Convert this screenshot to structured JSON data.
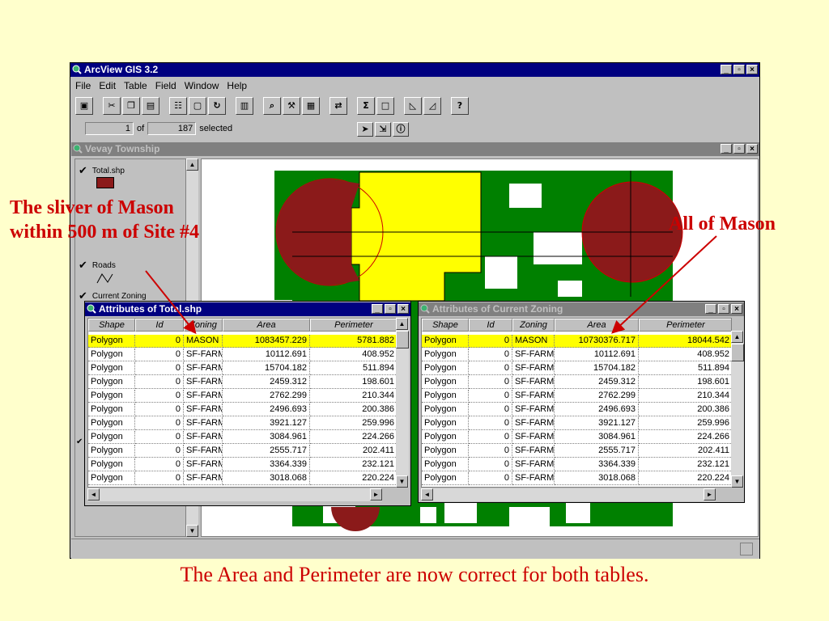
{
  "app": {
    "title": "ArcView GIS 3.2"
  },
  "menu": [
    "File",
    "Edit",
    "Table",
    "Field",
    "Window",
    "Help"
  ],
  "status": {
    "selected_count": "1",
    "of_label": "of",
    "total_count": "187",
    "selected_label": "selected"
  },
  "view": {
    "title": "Vevay Township",
    "toc_items": [
      {
        "label": "Total.shp",
        "checked": true
      },
      {
        "label": "Roads",
        "checked": true
      },
      {
        "label": "Current Zoning",
        "checked": true
      }
    ]
  },
  "tables": {
    "left": {
      "title": "Attributes of Total.shp",
      "columns": [
        "Shape",
        "Id",
        "Zoning",
        "Area",
        "Perimeter"
      ],
      "rows": [
        [
          "Polygon",
          "0",
          "MASON",
          "1083457.229",
          "5781.882"
        ],
        [
          "Polygon",
          "0",
          "SF-FARM",
          "10112.691",
          "408.952"
        ],
        [
          "Polygon",
          "0",
          "SF-FARM",
          "15704.182",
          "511.894"
        ],
        [
          "Polygon",
          "0",
          "SF-FARM",
          "2459.312",
          "198.601"
        ],
        [
          "Polygon",
          "0",
          "SF-FARM",
          "2762.299",
          "210.344"
        ],
        [
          "Polygon",
          "0",
          "SF-FARM",
          "2496.693",
          "200.386"
        ],
        [
          "Polygon",
          "0",
          "SF-FARM",
          "3921.127",
          "259.996"
        ],
        [
          "Polygon",
          "0",
          "SF-FARM",
          "3084.961",
          "224.266"
        ],
        [
          "Polygon",
          "0",
          "SF-FARM",
          "2555.717",
          "202.411"
        ],
        [
          "Polygon",
          "0",
          "SF-FARM",
          "3364.339",
          "232.121"
        ],
        [
          "Polygon",
          "0",
          "SF-FARM",
          "3018.068",
          "220.224"
        ]
      ]
    },
    "right": {
      "title": "Attributes of Current Zoning",
      "columns": [
        "Shape",
        "Id",
        "Zoning",
        "Area",
        "Perimeter"
      ],
      "rows": [
        [
          "Polygon",
          "0",
          "MASON",
          "10730376.717",
          "18044.542"
        ],
        [
          "Polygon",
          "0",
          "SF-FARM",
          "10112.691",
          "408.952"
        ],
        [
          "Polygon",
          "0",
          "SF-FARM",
          "15704.182",
          "511.894"
        ],
        [
          "Polygon",
          "0",
          "SF-FARM",
          "2459.312",
          "198.601"
        ],
        [
          "Polygon",
          "0",
          "SF-FARM",
          "2762.299",
          "210.344"
        ],
        [
          "Polygon",
          "0",
          "SF-FARM",
          "2496.693",
          "200.386"
        ],
        [
          "Polygon",
          "0",
          "SF-FARM",
          "3921.127",
          "259.996"
        ],
        [
          "Polygon",
          "0",
          "SF-FARM",
          "3084.961",
          "224.266"
        ],
        [
          "Polygon",
          "0",
          "SF-FARM",
          "2555.717",
          "202.411"
        ],
        [
          "Polygon",
          "0",
          "SF-FARM",
          "3364.339",
          "232.121"
        ],
        [
          "Polygon",
          "0",
          "SF-FARM",
          "3018.068",
          "220.224"
        ]
      ]
    }
  },
  "annotations": {
    "left_line1": "The sliver of Mason",
    "left_line2": "within 500 m of Site #4",
    "right": "All of Mason",
    "caption": "The Area and Perimeter are now correct for both tables."
  },
  "colors": {
    "background": "#FFFFCC",
    "titlebar": "#000080",
    "annotation": "#CC0000",
    "selected_row": "#FFFF00",
    "zoning_green": "#008000",
    "mason_yellow": "#FFFF00",
    "buffer_brown": "#8B1A1A"
  }
}
